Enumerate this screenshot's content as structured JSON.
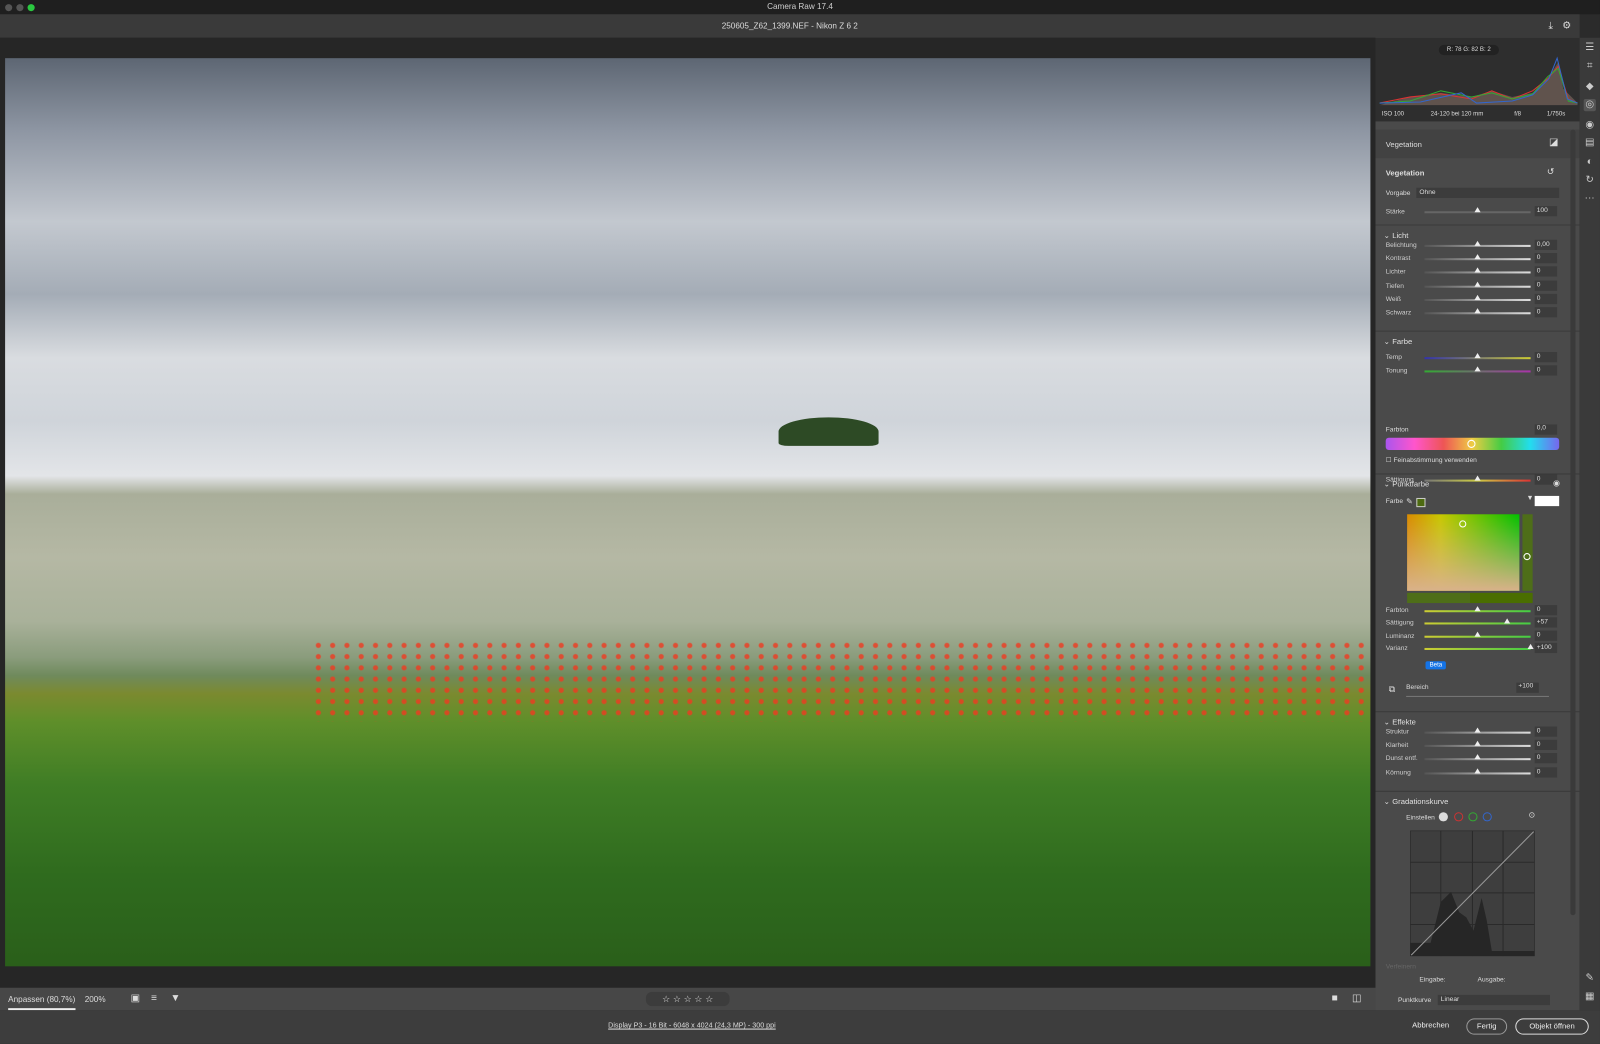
{
  "window": {
    "title": "Camera Raw 17.4",
    "file": "250605_Z62_1399.NEF - Nikon Z 6 2"
  },
  "histogram": {
    "rgb": "R: 78   G: 82   B: 2",
    "iso": "ISO 100",
    "lens": "24-120 bei 120 mm",
    "aperture": "f/8",
    "shutter": "1/750s"
  },
  "mask": {
    "name": "Vegetation",
    "title": "Vegetation",
    "preset_label": "Vorgabe",
    "preset": "Ohne",
    "amount_label": "Stärke",
    "amount": "100"
  },
  "licht": {
    "title": "Licht",
    "rows": [
      {
        "label": "Belichtung",
        "value": "0,00",
        "pos": 0.5
      },
      {
        "label": "Kontrast",
        "value": "0",
        "pos": 0.5
      },
      {
        "label": "Lichter",
        "value": "0",
        "pos": 0.5
      },
      {
        "label": "Tiefen",
        "value": "0",
        "pos": 0.5
      },
      {
        "label": "Weiß",
        "value": "0",
        "pos": 0.5
      },
      {
        "label": "Schwarz",
        "value": "0",
        "pos": 0.5
      }
    ]
  },
  "farbe": {
    "title": "Farbe",
    "temp_label": "Temp",
    "temp": "0",
    "tint_label": "Tonung",
    "tint": "0",
    "hue_label": "Farbton",
    "hue": "0,0",
    "fine_label": "Feinabstimmung verwenden",
    "sat_label": "Sättigung",
    "sat": "0",
    "color_label": "Farbe"
  },
  "punktfarbe": {
    "title": "Punktfarbe",
    "rows": [
      {
        "label": "Farbton",
        "value": "0",
        "pos": 0.5
      },
      {
        "label": "Sättigung",
        "value": "+57",
        "pos": 0.78
      },
      {
        "label": "Luminanz",
        "value": "0",
        "pos": 0.5
      },
      {
        "label": "Varianz",
        "value": "+100",
        "pos": 1
      }
    ],
    "beta": "Beta",
    "range_label": "Bereich",
    "range": "+100"
  },
  "effekte": {
    "title": "Effekte",
    "rows": [
      {
        "label": "Struktur",
        "value": "0",
        "pos": 0.5
      },
      {
        "label": "Klarheit",
        "value": "0",
        "pos": 0.5
      },
      {
        "label": "Dunst entf.",
        "value": "0",
        "pos": 0.5
      },
      {
        "label": "Körnung",
        "value": "0",
        "pos": 0.5
      }
    ]
  },
  "curve": {
    "title": "Gradationskurve",
    "adjust_label": "Einstellen",
    "refine_label": "Verfeinern",
    "input_label": "Eingabe:",
    "output_label": "Ausgabe:",
    "pointcurve_label": "Punktkurve",
    "pointcurve": "Linear"
  },
  "toolbar": {
    "fit": "Anpassen (80,7%)",
    "zoom": "200%",
    "stars": "☆ ☆ ☆ ☆ ☆"
  },
  "footer": {
    "info": "Display P3 - 16 Bit - 6048 x 4024 (24,3 MP) - 300 ppi",
    "cancel": "Abbrechen",
    "done": "Fertig",
    "open": "Objekt öffnen"
  }
}
